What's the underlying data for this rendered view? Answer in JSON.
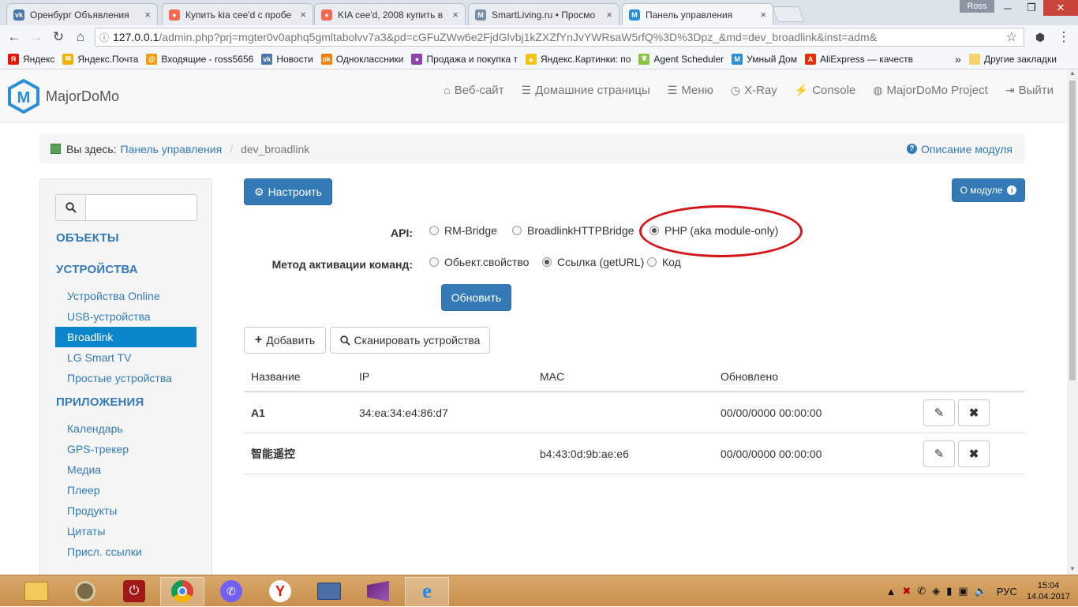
{
  "browser": {
    "tabs": [
      {
        "title": "Оренбург Объявления",
        "favicon": "vk-icon",
        "color": "#4a76a8",
        "glyph": "vk",
        "active": false
      },
      {
        "title": "Купить kia cee'd с пробе",
        "favicon": "avito-icon",
        "color": "#f2694f",
        "glyph": "●",
        "active": false
      },
      {
        "title": "KIA cee'd, 2008 купить в",
        "favicon": "avito-icon",
        "color": "#f2694f",
        "glyph": "●",
        "active": false
      },
      {
        "title": "SmartLiving.ru • Просмо",
        "favicon": "majordomo-icon",
        "color": "#7a8ea3",
        "glyph": "M",
        "active": false
      },
      {
        "title": "Панель управления",
        "favicon": "majordomo-icon",
        "color": "#2a8fd6",
        "glyph": "M",
        "active": true
      }
    ],
    "user": "Ross",
    "url_host": "127.0.0.1",
    "url_path": "/admin.php?prj=mgter0v0aphq5gmltabolvv7a3&pd=cGFuZWw6e2FjdGlvbj1kZXZfYnJvYWRsaW5rfQ%3D%3Dpz_&md=dev_broadlink&inst=adm&",
    "bookmarks": [
      {
        "label": "Яндекс",
        "icon": "yandex-icon",
        "color": "#e61400",
        "glyph": "Я"
      },
      {
        "label": "Яндекс.Почта",
        "icon": "mail-icon",
        "color": "#f0b400",
        "glyph": "✉"
      },
      {
        "label": "Входящие - ross5656",
        "icon": "inbox-icon",
        "color": "#f39c12",
        "glyph": "@"
      },
      {
        "label": "Новости",
        "icon": "vk-icon",
        "color": "#4a76a8",
        "glyph": "vk"
      },
      {
        "label": "Одноклассники",
        "icon": "ok-icon",
        "color": "#ee8208",
        "glyph": "ok"
      },
      {
        "label": "Продажа и покупка т",
        "icon": "avito-icon",
        "color": "#8e44ad",
        "glyph": "●"
      },
      {
        "label": "Яндекс.Картинки: по",
        "icon": "images-icon",
        "color": "#f1c40f",
        "glyph": "▲"
      },
      {
        "label": "Agent Scheduler",
        "icon": "leaf-icon",
        "color": "#8bc34a",
        "glyph": "❦"
      },
      {
        "label": "Умный Дом",
        "icon": "majordomo-icon",
        "color": "#2a8fd6",
        "glyph": "M"
      },
      {
        "label": "AliExpress — качеств",
        "icon": "aliexpress-icon",
        "color": "#e62e04",
        "glyph": "A"
      }
    ],
    "bookmarks_more": "»",
    "other_bookmarks": "Другие закладки"
  },
  "navbar": {
    "brand": "MajorDoMo",
    "items": [
      {
        "label": "Веб-сайт",
        "icon": "home-icon",
        "glyph": "⌂"
      },
      {
        "label": "Домашние страницы",
        "icon": "list-icon",
        "glyph": "☰"
      },
      {
        "label": "Меню",
        "icon": "menu-icon",
        "glyph": "☰"
      },
      {
        "label": "X-Ray",
        "icon": "xray-icon",
        "glyph": "◷"
      },
      {
        "label": "Console",
        "icon": "bolt-icon",
        "glyph": "⚡"
      },
      {
        "label": "MajorDoMo Project",
        "icon": "globe-icon",
        "glyph": "◍"
      },
      {
        "label": "Выйти",
        "icon": "logout-icon",
        "glyph": "⇥"
      }
    ]
  },
  "breadcrumb": {
    "lead": "Вы здесь:",
    "link": "Панель управления",
    "sep": "/",
    "current": "dev_broadlink",
    "help": "Описание модуля"
  },
  "sidebar": {
    "sections": [
      {
        "title": "ОБЪЕКТЫ",
        "items": []
      },
      {
        "title": "УСТРОЙСТВА",
        "items": [
          "Устройства Online",
          "USB-устройства",
          "Broadlink",
          "LG Smart TV",
          "Простые устройства"
        ]
      },
      {
        "title": "ПРИЛОЖЕНИЯ",
        "items": [
          "Календарь",
          "GPS-трекер",
          "Медиа",
          "Плеер",
          "Продукты",
          "Цитаты",
          "Присл. ссылки"
        ]
      }
    ],
    "active": "Broadlink"
  },
  "main": {
    "configure_label": "Настроить",
    "about_label": "О модуле",
    "api_label": "API:",
    "api_options": [
      {
        "label": "RM-Bridge",
        "checked": false
      },
      {
        "label": "BroadlinkHTTPBridge",
        "checked": false
      },
      {
        "label": "PHP (aka module-only)",
        "checked": true
      }
    ],
    "method_label": "Метод активации команд:",
    "method_options": [
      {
        "label": "Обьект.свойство",
        "checked": false
      },
      {
        "label": "Ссылка (getURL)",
        "checked": true
      },
      {
        "label": "Код",
        "checked": false
      }
    ],
    "update_label": "Обновить",
    "add_label": "Добавить",
    "scan_label": "Сканировать устройства",
    "table": {
      "headers": [
        "Название",
        "IP",
        "MAC",
        "Обновлено"
      ],
      "rows": [
        {
          "name": "A1",
          "ip": "34:ea:34:e4:86:d7",
          "mac": "",
          "updated": "00/00/0000 00:00:00"
        },
        {
          "name": "智能遥控",
          "ip": "",
          "mac": "b4:43:0d:9b:ae:e6",
          "updated": "00/00/0000 00:00:00"
        }
      ]
    }
  },
  "taskbar": {
    "lang": "РУС",
    "time": "15:04",
    "date": "14.04.2017"
  }
}
